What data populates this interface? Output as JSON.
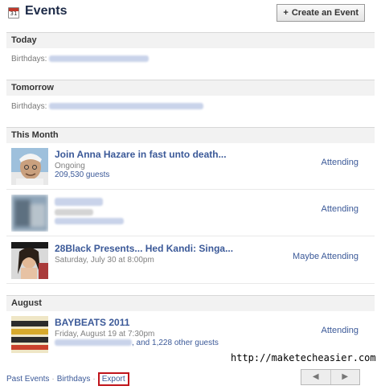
{
  "header": {
    "title": "Events",
    "calendar_day": "31",
    "create_label": "Create an Event",
    "create_plus": "+"
  },
  "sections": {
    "today": "Today",
    "tomorrow": "Tomorrow",
    "this_month": "This Month",
    "august": "August"
  },
  "birthdays": {
    "today_label": "Birthdays:",
    "tomorrow_label": "Birthdays:"
  },
  "events": [
    {
      "title": "Join Anna Hazare in fast unto death...",
      "subtitle": "Ongoing",
      "guests": "209,530 guests",
      "status": "Attending"
    },
    {
      "title": "",
      "subtitle": "",
      "guests": "",
      "status": "Attending"
    },
    {
      "title": "28Black Presents... Hed Kandi: Singa...",
      "subtitle": "Saturday, July 30 at 8:00pm",
      "guests": "",
      "status": "Maybe Attending"
    },
    {
      "title": "BAYBEATS 2011",
      "subtitle": "Friday, August 19 at 7:30pm",
      "guests": ", and 1,228 other guests",
      "status": "Attending"
    }
  ],
  "footer": {
    "past_events": "Past Events",
    "birthdays": "Birthdays",
    "export": "Export",
    "separator": "·",
    "prev": "◀",
    "next": "▶"
  },
  "watermark": "http://maketecheasier.com"
}
